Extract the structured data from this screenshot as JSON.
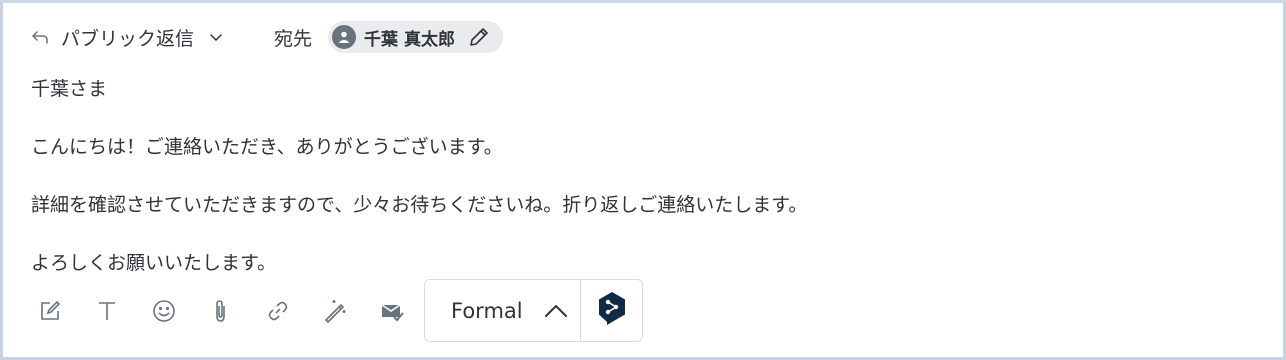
{
  "header": {
    "reply_type": "パブリック返信",
    "to_label": "宛先",
    "recipient_name": "千葉 真太郎"
  },
  "message": {
    "lines": [
      "千葉さま",
      "こんにちは！ご連絡いただき、ありがとうございます。",
      "詳細を確認させていただきますので、少々お待ちくださいね。折り返しご連絡いたします。",
      "よろしくお願いいたします。"
    ]
  },
  "toolbar": {
    "icons": [
      "compose-icon",
      "text-format-icon",
      "emoji-icon",
      "attachment-icon",
      "link-icon",
      "magic-wand-icon",
      "envelope-check-icon"
    ],
    "tone_value": "Formal",
    "translate_icon": "deepl-logo-icon"
  },
  "colors": {
    "icon_gray": "#68737d",
    "chip_bg": "#e9ebed",
    "deepl_navy": "#0f2b46",
    "frame_border": "#c6d3e4"
  }
}
